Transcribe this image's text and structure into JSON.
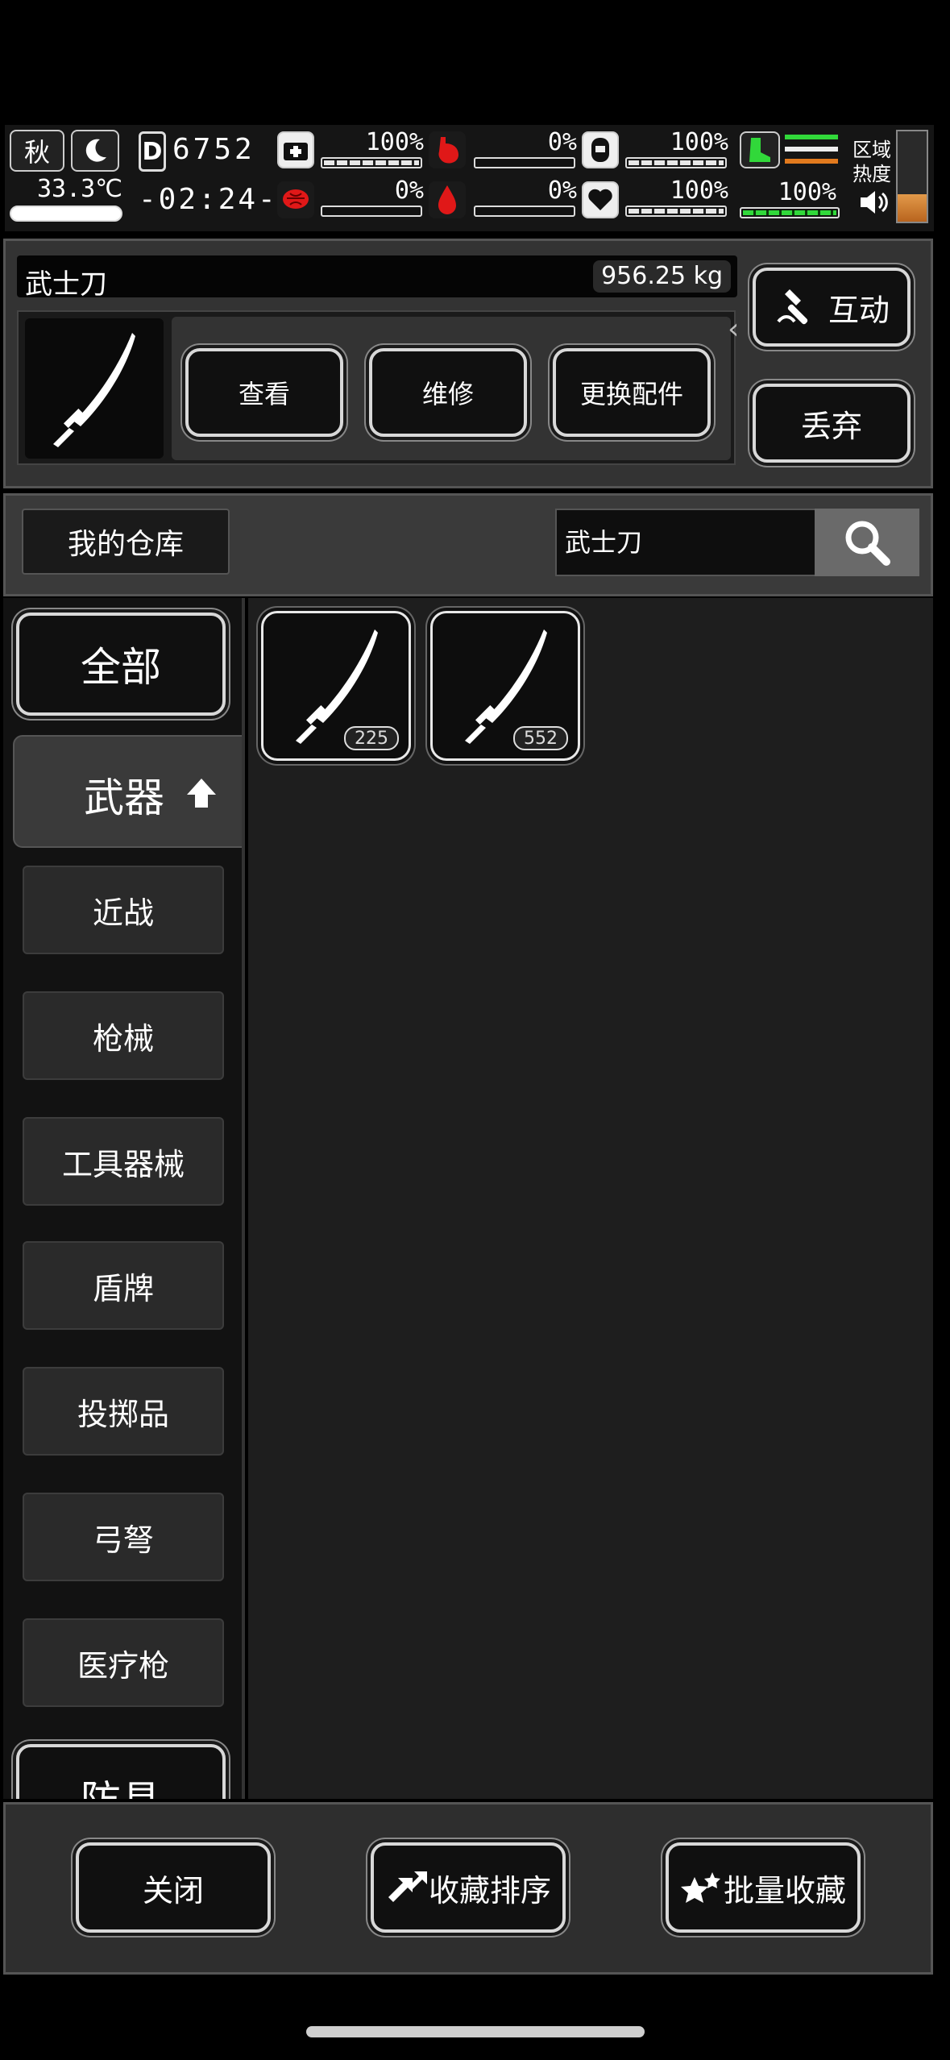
{
  "status": {
    "season": "秋",
    "temperature": "33.3℃",
    "day_counter": "6752",
    "time": "-02:24-",
    "health_pct": "100%",
    "hunger_pct": "0%",
    "water_pct": "100%",
    "brain_pct": "0%",
    "blood_pct": "0%",
    "mood_pct": "100%",
    "stamina_pct": "100%",
    "zone_heat_label_1": "区域",
    "zone_heat_label_2": "热度"
  },
  "item": {
    "name": "武士刀",
    "weight": "956.25 kg",
    "actions": [
      "查看",
      "维修",
      "更换配件"
    ],
    "interact_label": "互动",
    "discard_label": "丢弃"
  },
  "storage": {
    "title": "我的仓库",
    "search_value": "武士刀"
  },
  "categories": {
    "all": "全部",
    "weapons": "武器",
    "sub": [
      "近战",
      "枪械",
      "工具器械",
      "盾牌",
      "投掷品",
      "弓弩",
      "医疗枪"
    ],
    "armor": "防具"
  },
  "grid_items": [
    {
      "name": "武士刀",
      "count": "225",
      "icon": "katana-icon"
    },
    {
      "name": "武士刀",
      "count": "552",
      "icon": "katana-icon"
    }
  ],
  "footer": {
    "close": "关闭",
    "sort": "收藏排序",
    "batch": "批量收藏"
  },
  "colors": {
    "accent_green": "#31d83a",
    "alert_red": "#e01818",
    "heat_orange": "#d9823a"
  }
}
